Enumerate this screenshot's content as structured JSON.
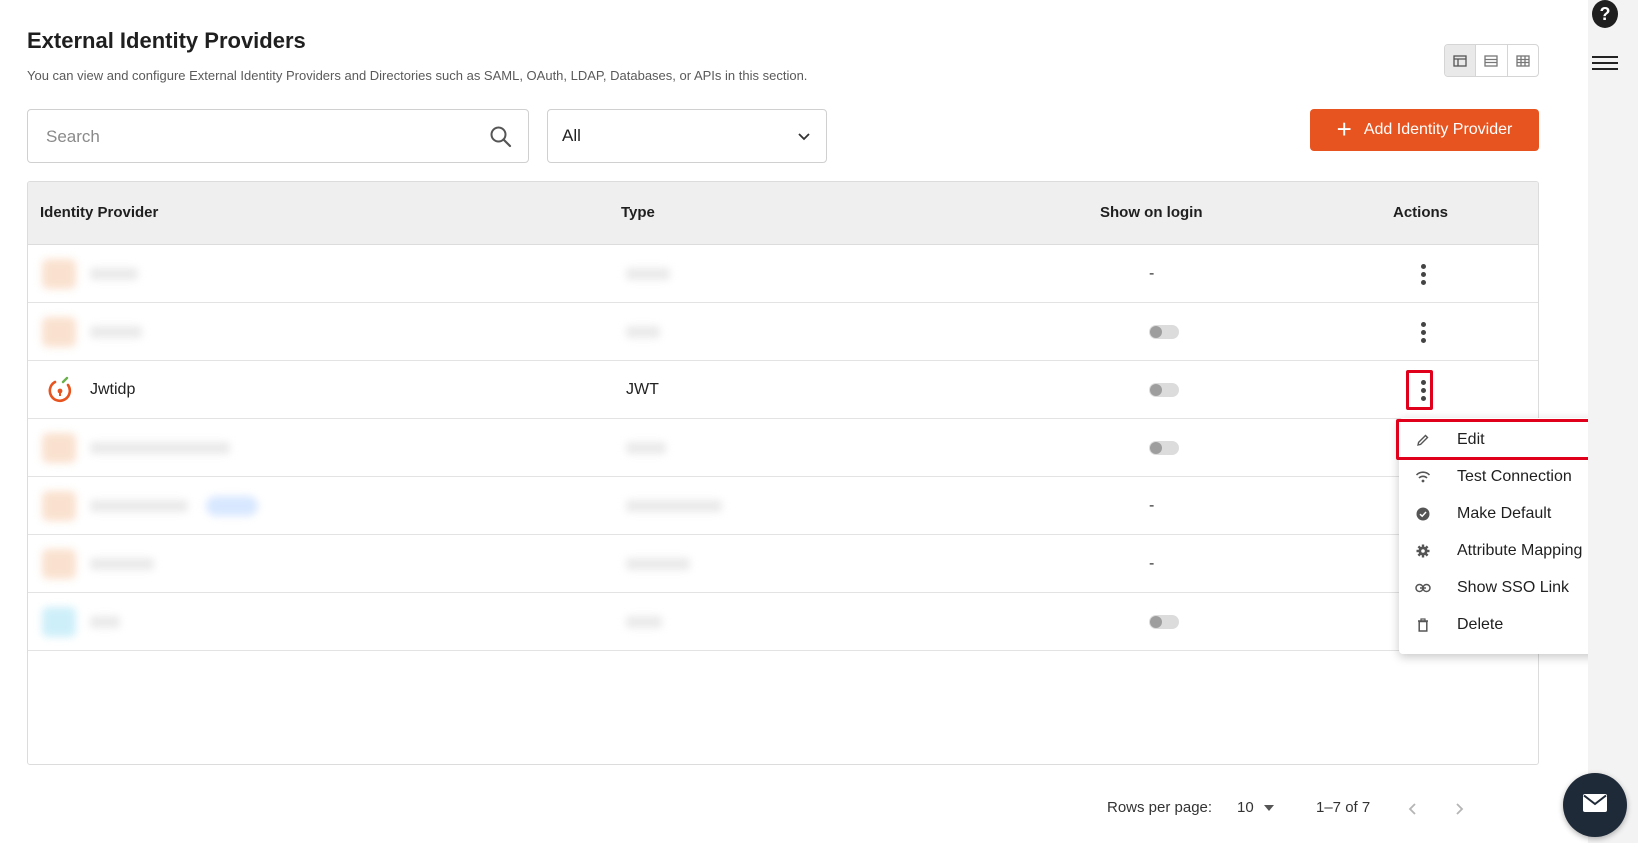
{
  "header": {
    "title": "External Identity Providers",
    "subtitle": "You can view and configure External Identity Providers and Directories such as SAML, OAuth, LDAP, Databases, or APIs in this section."
  },
  "view_toggle": {
    "icons": [
      "table-view-icon",
      "list-view-icon",
      "grid-view-icon"
    ],
    "active": "table-view-icon"
  },
  "search": {
    "placeholder": "Search",
    "value": ""
  },
  "type_filter": {
    "selected": "All"
  },
  "add_button": {
    "label": "Add Identity Provider",
    "color": "#e8541f"
  },
  "table": {
    "columns": [
      "Identity Provider",
      "Type",
      "Show on login",
      "Actions"
    ],
    "rows": [
      {
        "name": "",
        "type": "",
        "show_on_login": "-",
        "blurred": true
      },
      {
        "name": "",
        "type": "",
        "show_on_login": "toggle-off",
        "blurred": true
      },
      {
        "name": "Jwtidp",
        "type": "JWT",
        "show_on_login": "toggle-off",
        "blurred": false
      },
      {
        "name": "",
        "type": "",
        "show_on_login": "toggle-off",
        "blurred": true
      },
      {
        "name": "",
        "type": "",
        "show_on_login": "-",
        "blurred": true
      },
      {
        "name": "",
        "type": "",
        "show_on_login": "-",
        "blurred": true
      },
      {
        "name": "",
        "type": "",
        "show_on_login": "toggle-off",
        "blurred": true
      }
    ],
    "dash": "-"
  },
  "actions_menu": {
    "items": [
      {
        "label": "Edit",
        "icon": "pencil-icon"
      },
      {
        "label": "Test Connection",
        "icon": "wifi-icon"
      },
      {
        "label": "Make Default",
        "icon": "check-circle-icon"
      },
      {
        "label": "Attribute Mapping",
        "icon": "gear-icon"
      },
      {
        "label": "Show SSO Link",
        "icon": "link-icon"
      },
      {
        "label": "Delete",
        "icon": "trash-icon"
      }
    ]
  },
  "pagination": {
    "rows_per_page_label": "Rows per page:",
    "rows_per_page": "10",
    "range": "1–7 of 7"
  },
  "colors": {
    "accent": "#e8541f",
    "highlight": "#e0001b"
  }
}
